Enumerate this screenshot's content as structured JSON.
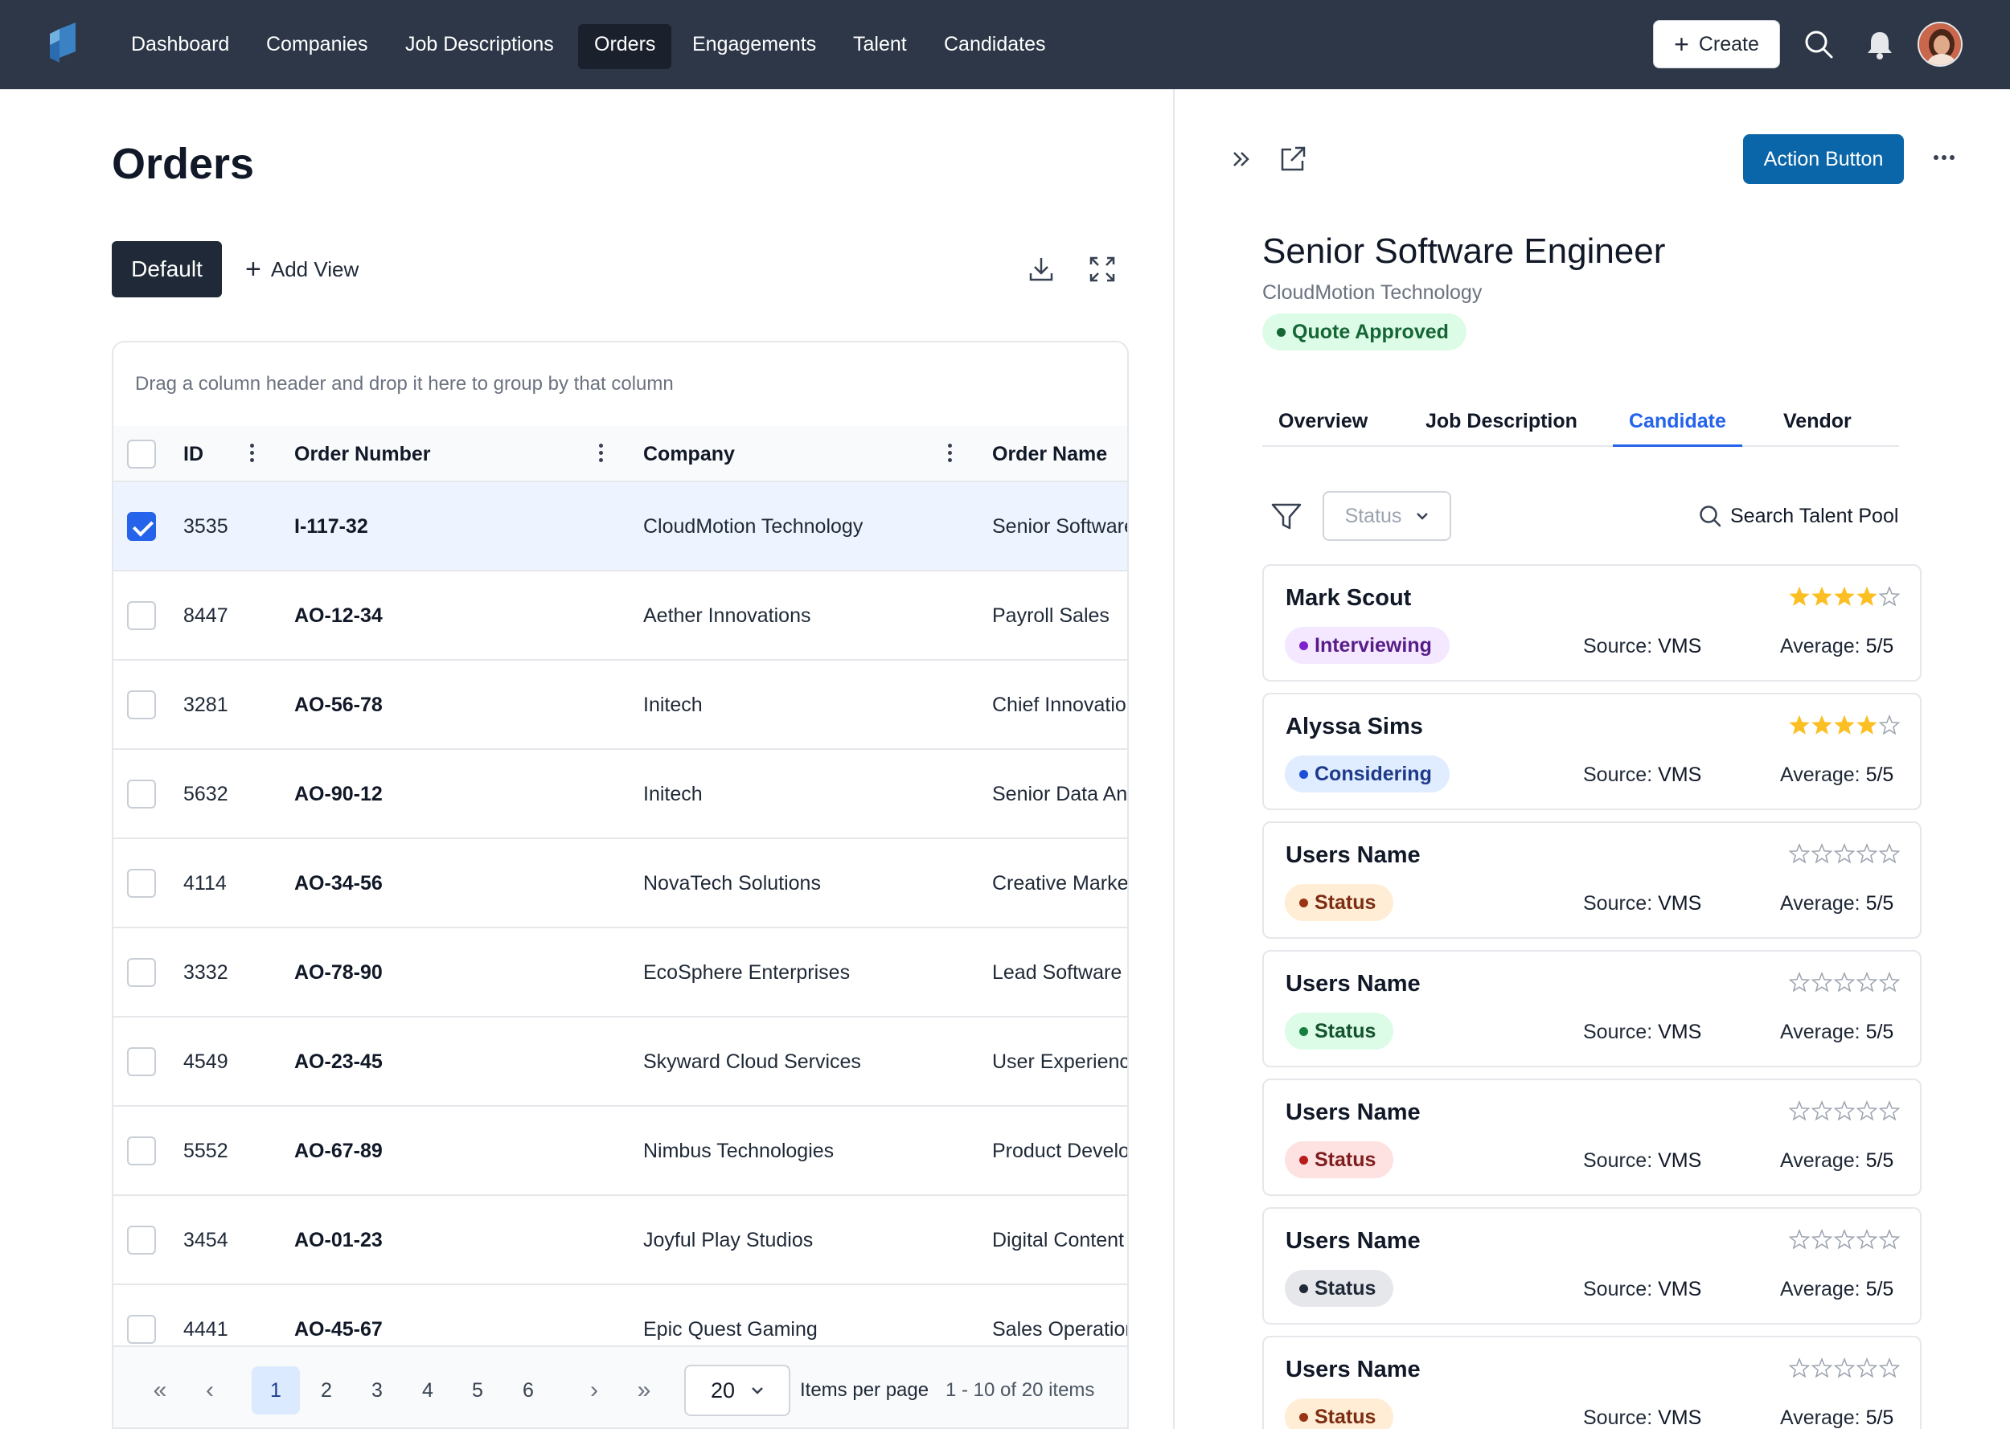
{
  "nav": {
    "items": [
      "Dashboard",
      "Companies",
      "Job Descriptions",
      "Orders",
      "Engagements",
      "Talent",
      "Candidates"
    ],
    "active_index": 3,
    "create_label": "Create"
  },
  "page": {
    "title": "Orders",
    "view_default": "Default",
    "add_view": "Add View"
  },
  "grid": {
    "group_hint": "Drag a column header and drop it here to group by that column",
    "columns": [
      "ID",
      "Order Number",
      "Company",
      "Order Name"
    ],
    "rows": [
      {
        "id": "3535",
        "order_number": "I-117-32",
        "company": "CloudMotion Technology",
        "order_name": "Senior Software Engineer",
        "selected": true
      },
      {
        "id": "8447",
        "order_number": "AO-12-34",
        "company": "Aether Innovations",
        "order_name": "Payroll Sales",
        "selected": false
      },
      {
        "id": "3281",
        "order_number": "AO-56-78",
        "company": "Initech",
        "order_name": "Chief Innovation Officer",
        "selected": false
      },
      {
        "id": "5632",
        "order_number": "AO-90-12",
        "company": "Initech",
        "order_name": "Senior Data Analyst",
        "selected": false
      },
      {
        "id": "4114",
        "order_number": "AO-34-56",
        "company": "NovaTech Solutions",
        "order_name": "Creative Marketing Lead",
        "selected": false
      },
      {
        "id": "3332",
        "order_number": "AO-78-90",
        "company": "EcoSphere Enterprises",
        "order_name": "Lead Software Engineer",
        "selected": false
      },
      {
        "id": "4549",
        "order_number": "AO-23-45",
        "company": "Skyward Cloud Services",
        "order_name": "User Experience Designer",
        "selected": false
      },
      {
        "id": "5552",
        "order_number": "AO-67-89",
        "company": "Nimbus Technologies",
        "order_name": "Product Development Lead",
        "selected": false
      },
      {
        "id": "3454",
        "order_number": "AO-01-23",
        "company": "Joyful Play Studios",
        "order_name": "Digital Content Manager",
        "selected": false
      },
      {
        "id": "4441",
        "order_number": "AO-45-67",
        "company": "Epic Quest Gaming",
        "order_name": "Sales Operations Manager",
        "selected": false
      }
    ]
  },
  "pagination": {
    "pages": [
      "1",
      "2",
      "3",
      "4",
      "5",
      "6"
    ],
    "current_page": "1",
    "per_page": "20",
    "per_page_label": "Items per page",
    "range_text": "1 - 10 of 20 items"
  },
  "detail": {
    "action_button": "Action Button",
    "title": "Senior Software Engineer",
    "company": "CloudMotion Technology",
    "status": "Quote Approved",
    "tabs": [
      "Overview",
      "Job Description",
      "Candidate",
      "Vendor"
    ],
    "active_tab": "Candidate",
    "status_filter_placeholder": "Status",
    "search_label": "Search Talent Pool",
    "source_label": "Source:",
    "average_label": "Average:",
    "candidates": [
      {
        "name": "Mark Scout",
        "status": "Interviewing",
        "status_color": "purple",
        "source": "VMS",
        "average": "5/5",
        "stars": 4
      },
      {
        "name": "Alyssa Sims",
        "status": "Considering",
        "status_color": "blue",
        "source": "VMS",
        "average": "5/5",
        "stars": 4
      },
      {
        "name": "Users Name",
        "status": "Status",
        "status_color": "orange",
        "source": "VMS",
        "average": "5/5",
        "stars": 0
      },
      {
        "name": "Users Name",
        "status": "Status",
        "status_color": "green",
        "source": "VMS",
        "average": "5/5",
        "stars": 0
      },
      {
        "name": "Users Name",
        "status": "Status",
        "status_color": "red",
        "source": "VMS",
        "average": "5/5",
        "stars": 0
      },
      {
        "name": "Users Name",
        "status": "Status",
        "status_color": "gray",
        "source": "VMS",
        "average": "5/5",
        "stars": 0
      },
      {
        "name": "Users Name",
        "status": "Status",
        "status_color": "orange",
        "source": "VMS",
        "average": "5/5",
        "stars": 0
      }
    ]
  },
  "colors": {
    "topbar": "#2d3748",
    "primary": "#0a66a8",
    "link": "#2563eb",
    "star": "#fbbf24",
    "status": {
      "approved": {
        "bg": "#dcfce7",
        "fg": "#166534",
        "dot": "#166534"
      },
      "purple": {
        "bg": "#f3e8ff",
        "fg": "#581c87",
        "dot": "#7e22ce"
      },
      "blue": {
        "bg": "#e0ecff",
        "fg": "#1e3a8a",
        "dot": "#1d4ed8"
      },
      "orange": {
        "bg": "#ffedd5",
        "fg": "#7c2d12",
        "dot": "#9a3412"
      },
      "green": {
        "bg": "#dcfce7",
        "fg": "#14532d",
        "dot": "#15803d"
      },
      "red": {
        "bg": "#fee2e2",
        "fg": "#7f1d1d",
        "dot": "#b91c1c"
      },
      "gray": {
        "bg": "#e5e7eb",
        "fg": "#1f2937",
        "dot": "#1f2937"
      }
    }
  }
}
